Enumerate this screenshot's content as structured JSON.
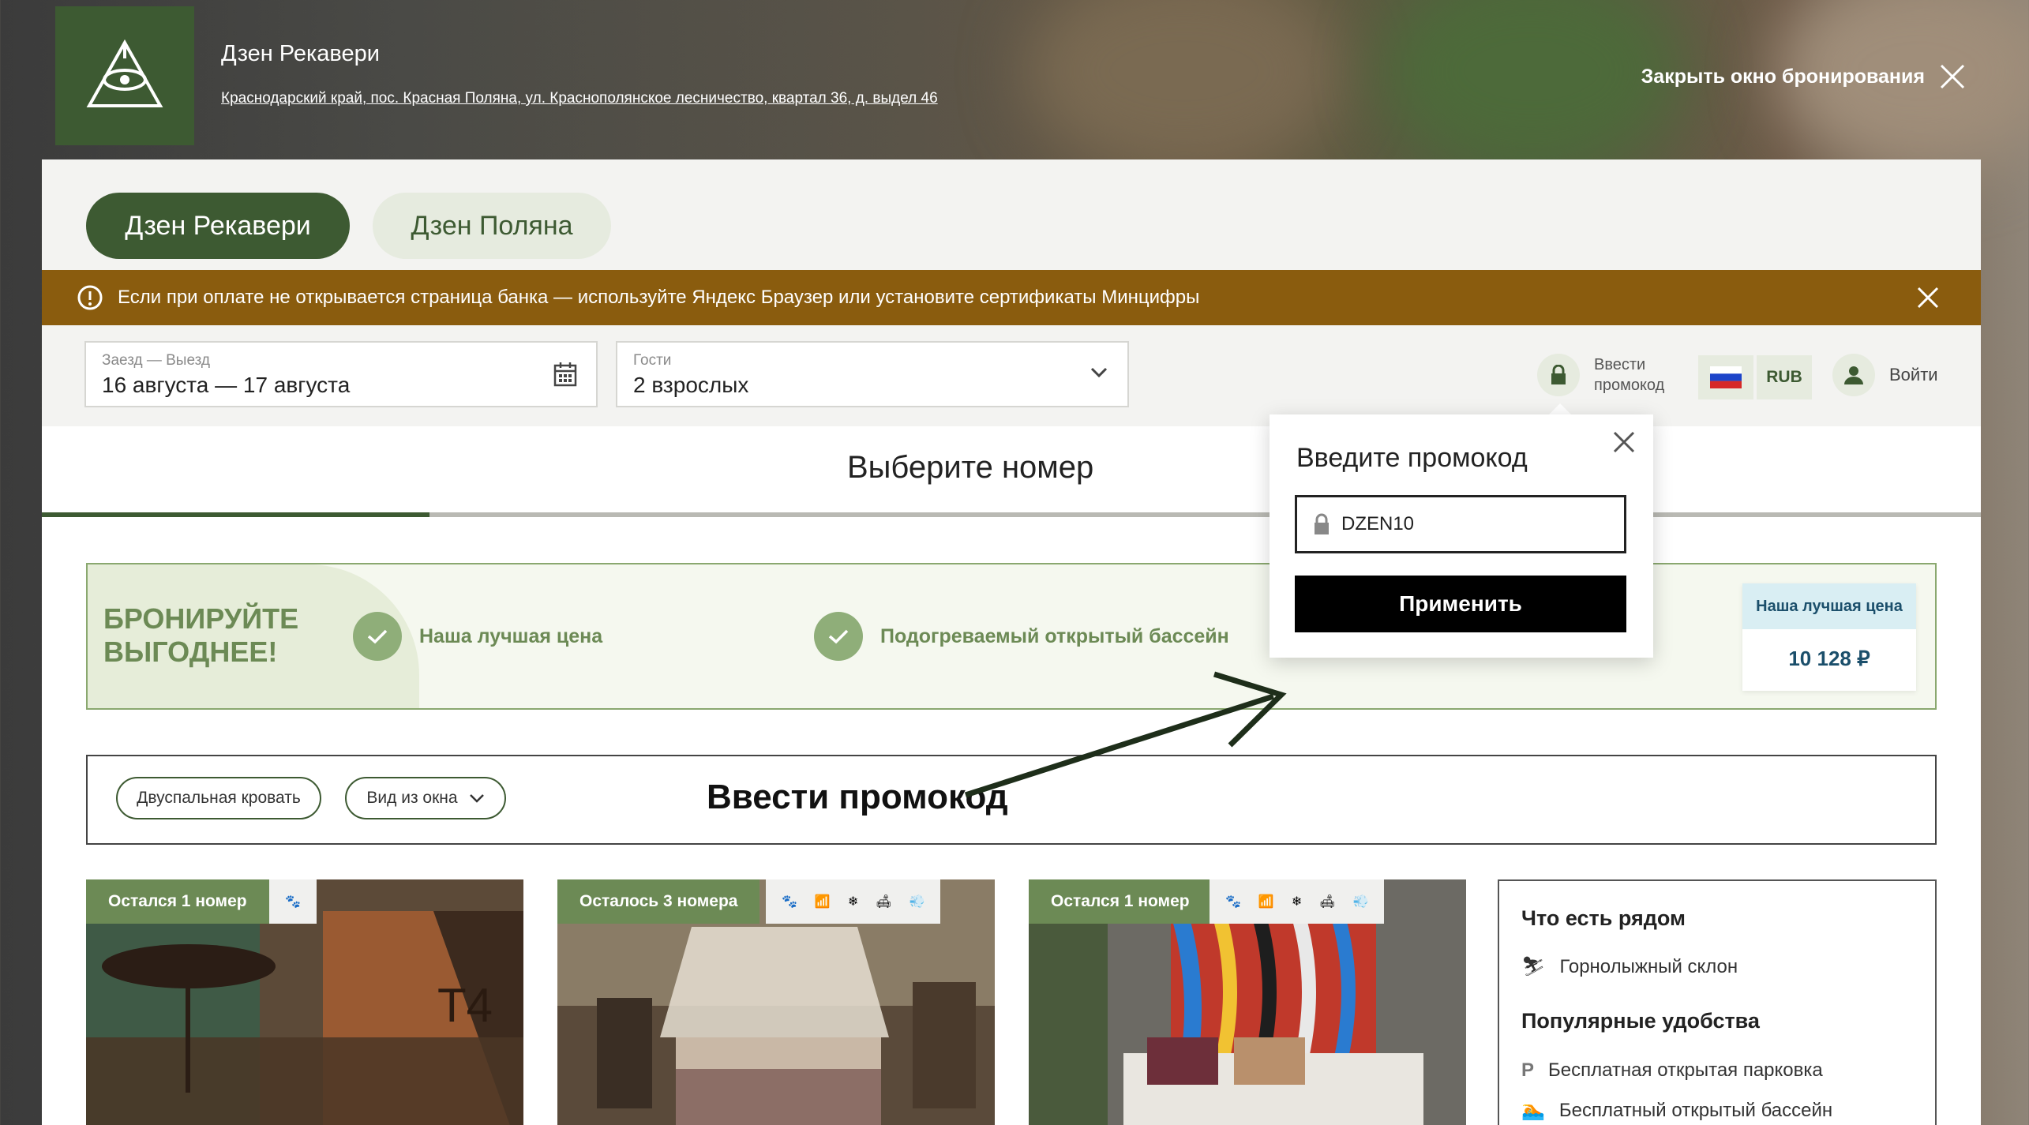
{
  "header": {
    "hotel_name": "Дзен Рекавери",
    "address": "Краснодарский край, пос. Красная Поляна, ул. Краснополянское лесничество, квартал 36, д. выдел 46",
    "close_label": "Закрыть окно бронирования"
  },
  "tabs": [
    {
      "label": "Дзен Рекавери",
      "active": true
    },
    {
      "label": "Дзен Поляна",
      "active": false
    }
  ],
  "notice": {
    "text": "Если при оплате не открывается страница банка — используйте Яндекс Браузер или установите сертификаты Минцифры"
  },
  "search": {
    "dates_label": "Заезд — Выезд",
    "dates_value": "16 августа — 17 августа",
    "guests_label": "Гости",
    "guests_value": "2 взрослых",
    "promo_label": "Ввести промокод",
    "currency": "RUB",
    "login": "Войти"
  },
  "step_title": "Выберите номер",
  "progress": 0.2,
  "banner": {
    "title_line1": "БРОНИРУЙТЕ",
    "title_line2": "ВЫГОДНЕЕ!",
    "benefits": [
      "Наша лучшая цена",
      "Подогреваемый открытый бассейн"
    ],
    "price_tag": "Наша лучшая цена",
    "price_value": "10 128 ₽"
  },
  "filters": {
    "chips": [
      "Двуспальная кровать",
      "Вид из окна"
    ]
  },
  "annotation": "Ввести промокод",
  "rooms": [
    {
      "availability": "Остался 1 номер"
    },
    {
      "availability": "Осталось 3 номера"
    },
    {
      "availability": "Остался 1 номер"
    }
  ],
  "nearby": {
    "title": "Что есть рядом",
    "items": [
      "Горнолыжный склон"
    ],
    "amenities_title": "Популярные удобства",
    "amenities": [
      "Бесплатная открытая парковка",
      "Бесплатный открытый бассейн"
    ]
  },
  "promo_popup": {
    "title": "Введите промокод",
    "input_value": "DZEN10",
    "apply_label": "Применить"
  },
  "colors": {
    "brand_green": "#3d5a32",
    "notice_brown": "#8a5c0e",
    "price_blue": "#1b4f6b"
  }
}
